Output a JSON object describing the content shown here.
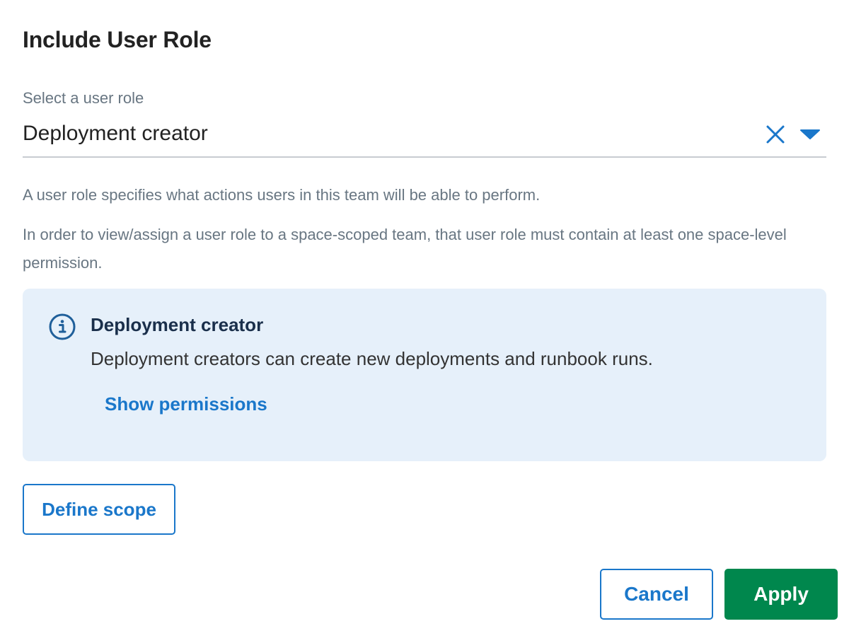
{
  "dialog": {
    "title": "Include User Role"
  },
  "role_select": {
    "label": "Select a user role",
    "value": "Deployment creator",
    "clear_icon": "close-icon",
    "dropdown_icon": "caret-down-icon"
  },
  "help": {
    "line1": "A user role specifies what actions users in this team will be able to perform.",
    "line2": "In order to view/assign a user role to a space-scoped team, that user role must contain at least one space-level permission."
  },
  "info": {
    "icon": "info-icon",
    "title": "Deployment creator",
    "description": "Deployment creators can create new deployments and runbook runs.",
    "link": "Show permissions"
  },
  "actions": {
    "define_scope": "Define scope",
    "cancel": "Cancel",
    "apply": "Apply"
  },
  "colors": {
    "accent": "#1a77ca",
    "primary_button": "#00874d",
    "info_background": "#e6f0fa",
    "muted_text": "#687682"
  }
}
